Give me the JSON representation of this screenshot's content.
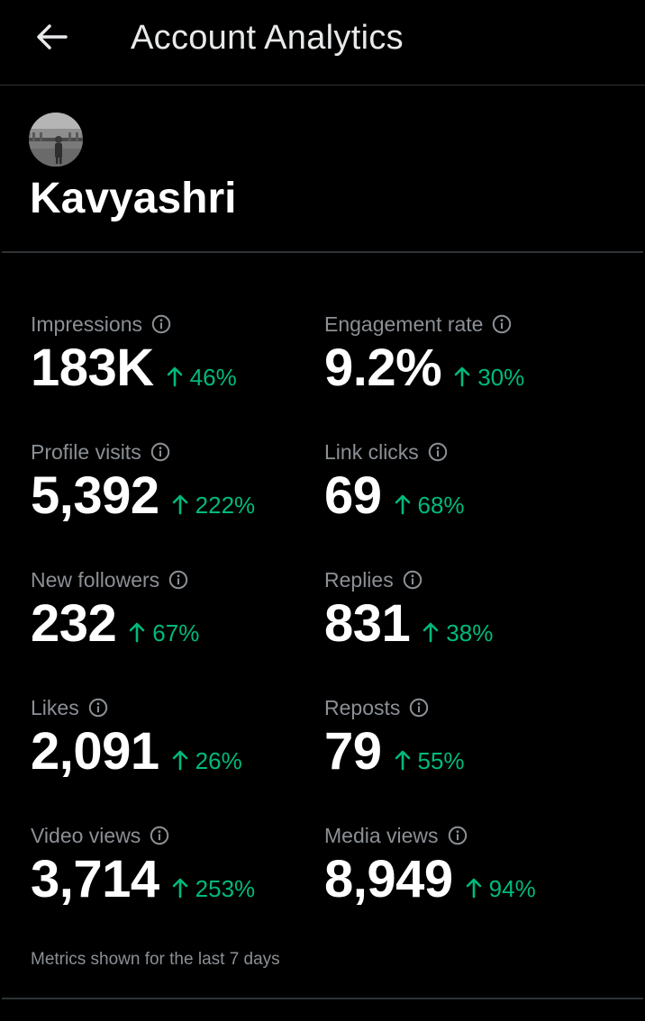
{
  "header": {
    "title": "Account Analytics",
    "back_icon": "arrow-left-icon"
  },
  "profile": {
    "name": "Kavyashri",
    "avatar_icon": "avatar"
  },
  "metrics": [
    {
      "label": "Impressions",
      "value": "183K",
      "change": "46%"
    },
    {
      "label": "Engagement rate",
      "value": "9.2%",
      "change": "30%"
    },
    {
      "label": "Profile visits",
      "value": "5,392",
      "change": "222%"
    },
    {
      "label": "Link clicks",
      "value": "69",
      "change": "68%"
    },
    {
      "label": "New followers",
      "value": "232",
      "change": "67%"
    },
    {
      "label": "Replies",
      "value": "831",
      "change": "38%"
    },
    {
      "label": "Likes",
      "value": "2,091",
      "change": "26%"
    },
    {
      "label": "Reposts",
      "value": "79",
      "change": "55%"
    },
    {
      "label": "Video views",
      "value": "3,714",
      "change": "253%"
    },
    {
      "label": "Media views",
      "value": "8,949",
      "change": "94%"
    }
  ],
  "footnote": "Metrics shown for the last 7 days",
  "colors": {
    "background": "#000000",
    "positive": "#00ba7c",
    "muted_text": "#8b9095",
    "primary_text": "#ffffff",
    "divider": "#2f3336"
  }
}
